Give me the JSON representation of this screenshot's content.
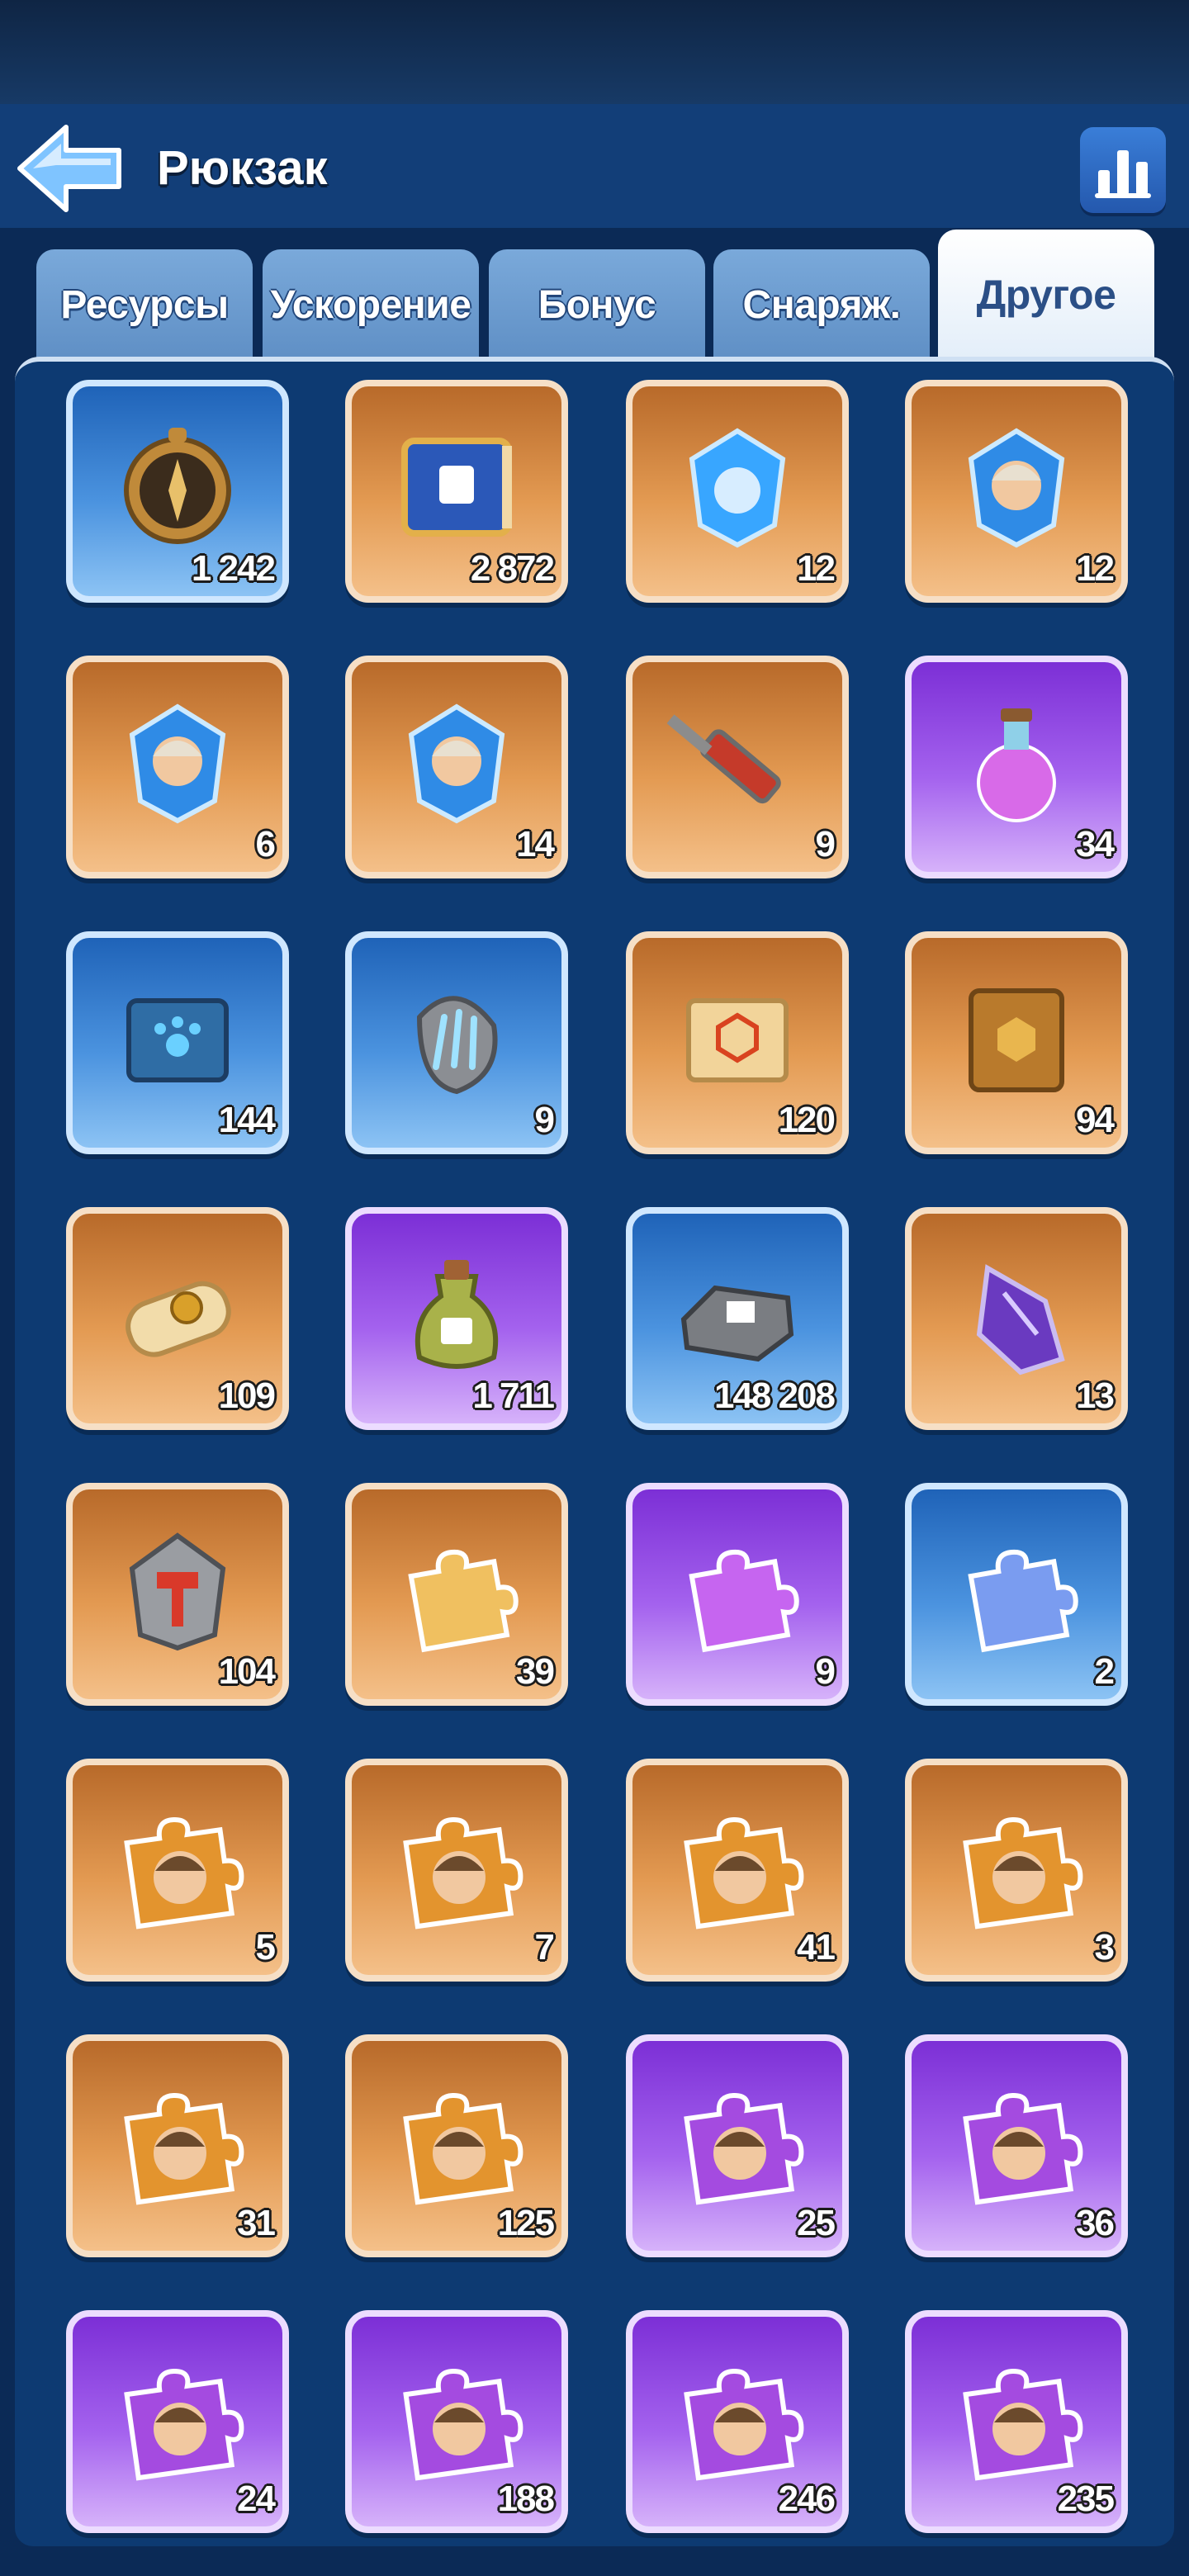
{
  "header": {
    "title": "Рюкзак",
    "back_icon": "arrow-left-icon",
    "stats_icon": "bar-chart-icon"
  },
  "tabs": [
    {
      "label": "Ресурсы",
      "active": false
    },
    {
      "label": "Ускорение",
      "active": false
    },
    {
      "label": "Бонус",
      "active": false
    },
    {
      "label": "Снаряж.",
      "active": false
    },
    {
      "label": "Другое",
      "active": true
    }
  ],
  "colors": {
    "orange": "#e39a52",
    "blue": "#4b93df",
    "purple": "#a462ee",
    "background": "#0d3a72"
  },
  "items": [
    {
      "icon": "compass-icon",
      "rarity": "blue",
      "qty": "1 242"
    },
    {
      "icon": "guide-book-icon",
      "rarity": "orange",
      "qty": "2 872"
    },
    {
      "icon": "blue-crystal-icon",
      "rarity": "orange",
      "qty": "12"
    },
    {
      "icon": "hero-crystal-icon",
      "rarity": "orange",
      "qty": "12"
    },
    {
      "icon": "hero-crystal-icon",
      "rarity": "orange",
      "qty": "6"
    },
    {
      "icon": "hero-crystal-icon",
      "rarity": "orange",
      "qty": "14"
    },
    {
      "icon": "syringe-icon",
      "rarity": "orange",
      "qty": "9"
    },
    {
      "icon": "potion-icon",
      "rarity": "purple",
      "qty": "34"
    },
    {
      "icon": "paw-book-icon",
      "rarity": "blue",
      "qty": "144"
    },
    {
      "icon": "claw-stone-icon",
      "rarity": "blue",
      "qty": "9"
    },
    {
      "icon": "scroll-icon",
      "rarity": "orange",
      "qty": "120"
    },
    {
      "icon": "gold-book-icon",
      "rarity": "orange",
      "qty": "94"
    },
    {
      "icon": "sealed-scroll-icon",
      "rarity": "orange",
      "qty": "109"
    },
    {
      "icon": "bottle-icon",
      "rarity": "purple",
      "qty": "1 711"
    },
    {
      "icon": "iron-ingot-icon",
      "rarity": "blue",
      "qty": "148 208"
    },
    {
      "icon": "purple-crystal-icon",
      "rarity": "orange",
      "qty": "13"
    },
    {
      "icon": "hammer-stone-icon",
      "rarity": "orange",
      "qty": "104"
    },
    {
      "icon": "puzzle-piece-icon",
      "rarity": "orange",
      "qty": "39"
    },
    {
      "icon": "puzzle-piece-icon",
      "rarity": "purple",
      "qty": "9"
    },
    {
      "icon": "puzzle-piece-icon",
      "rarity": "blue",
      "qty": "2"
    },
    {
      "icon": "hero-puzzle-icon",
      "rarity": "orange",
      "qty": "5"
    },
    {
      "icon": "hero-puzzle-icon",
      "rarity": "orange",
      "qty": "7"
    },
    {
      "icon": "hero-puzzle-icon",
      "rarity": "orange",
      "qty": "41"
    },
    {
      "icon": "hero-puzzle-icon",
      "rarity": "orange",
      "qty": "3"
    },
    {
      "icon": "hero-puzzle-icon",
      "rarity": "orange",
      "qty": "31"
    },
    {
      "icon": "hero-puzzle-icon",
      "rarity": "orange",
      "qty": "125"
    },
    {
      "icon": "hero-puzzle-icon",
      "rarity": "purple",
      "qty": "25"
    },
    {
      "icon": "hero-puzzle-icon",
      "rarity": "purple",
      "qty": "36"
    },
    {
      "icon": "hero-puzzle-icon",
      "rarity": "purple",
      "qty": "24"
    },
    {
      "icon": "hero-puzzle-icon",
      "rarity": "purple",
      "qty": "188"
    },
    {
      "icon": "hero-puzzle-icon",
      "rarity": "purple",
      "qty": "246"
    },
    {
      "icon": "hero-puzzle-icon",
      "rarity": "purple",
      "qty": "235"
    }
  ]
}
